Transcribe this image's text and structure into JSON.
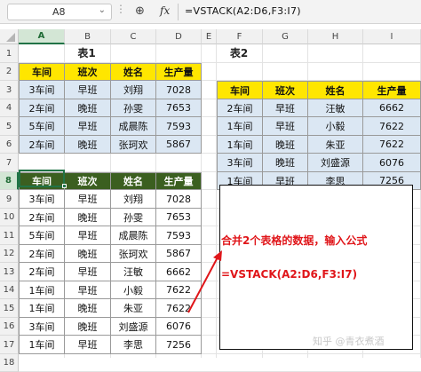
{
  "formula_bar": {
    "cell_ref": "A8",
    "fx_label": "fx",
    "formula": "=VSTACK(A2:D6,F3:I7)"
  },
  "columns": [
    "A",
    "B",
    "C",
    "D",
    "E",
    "F",
    "G",
    "H",
    "I"
  ],
  "rows": [
    "1",
    "2",
    "3",
    "4",
    "5",
    "6",
    "7",
    "8",
    "9",
    "10",
    "11",
    "12",
    "13",
    "14",
    "15",
    "16",
    "17",
    "18"
  ],
  "table1": {
    "title": "表1",
    "headers": [
      "车间",
      "班次",
      "姓名",
      "生产量"
    ],
    "rows": [
      [
        "3车间",
        "早班",
        "刘翔",
        "7028"
      ],
      [
        "2车间",
        "晚班",
        "孙雯",
        "7653"
      ],
      [
        "5车间",
        "早班",
        "成晨陈",
        "7593"
      ],
      [
        "2车间",
        "晚班",
        "张珂欢",
        "5867"
      ]
    ]
  },
  "table2": {
    "title": "表2",
    "headers": [
      "车间",
      "班次",
      "姓名",
      "生产量"
    ],
    "rows": [
      [
        "2车间",
        "早班",
        "汪敏",
        "6662"
      ],
      [
        "1车间",
        "早班",
        "小毅",
        "7622"
      ],
      [
        "1车间",
        "晚班",
        "朱亚",
        "7622"
      ],
      [
        "3车间",
        "晚班",
        "刘盛源",
        "6076"
      ],
      [
        "1车间",
        "早班",
        "李思",
        "7256"
      ]
    ]
  },
  "result": {
    "headers": [
      "车间",
      "班次",
      "姓名",
      "生产量"
    ],
    "rows": [
      [
        "3车间",
        "早班",
        "刘翔",
        "7028"
      ],
      [
        "2车间",
        "晚班",
        "孙雯",
        "7653"
      ],
      [
        "5车间",
        "早班",
        "成晨陈",
        "7593"
      ],
      [
        "2车间",
        "晚班",
        "张珂欢",
        "5867"
      ],
      [
        "2车间",
        "早班",
        "汪敏",
        "6662"
      ],
      [
        "1车间",
        "早班",
        "小毅",
        "7622"
      ],
      [
        "1车间",
        "晚班",
        "朱亚",
        "7622"
      ],
      [
        "3车间",
        "晚班",
        "刘盛源",
        "6076"
      ],
      [
        "1车间",
        "早班",
        "李思",
        "7256"
      ]
    ]
  },
  "annotation": {
    "line1": "合并2个表格的数据，输入公式",
    "line2": "=VSTACK(A2:D6,F3:I7)"
  },
  "watermark": "知乎 @青衣煮酒",
  "colors": {
    "header_yellow": "#ffe600",
    "header_green": "#3b5f20",
    "row_blue": "#dbe7f3",
    "annotation_red": "#e0161a",
    "selection_green": "#217346"
  }
}
